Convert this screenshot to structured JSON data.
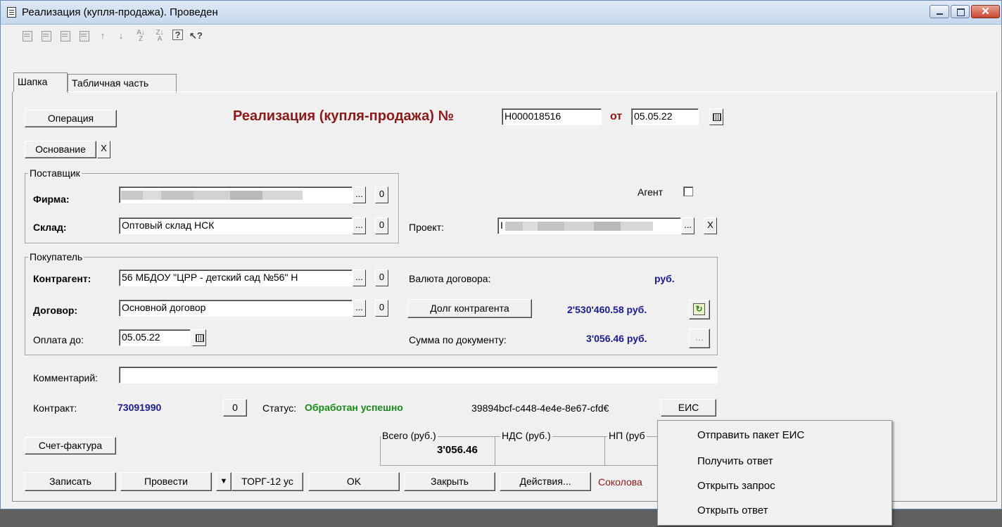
{
  "window": {
    "title": "Реализация (купля-продажа). Проведен",
    "close_glyph": "✕"
  },
  "toolbar": {
    "icons": [
      "new-doc-icon",
      "copy-doc-icon",
      "edit-doc-icon",
      "delete-doc-icon",
      "move-up-icon",
      "move-down-icon",
      "sort-asc-icon",
      "sort-desc-icon",
      "help-icon",
      "context-help-icon"
    ]
  },
  "tabs": [
    {
      "label": "Шапка"
    },
    {
      "label": "Табличная часть"
    }
  ],
  "header": {
    "operation_button": "Операция",
    "doc_title": "Реализация (купля-продажа) №",
    "doc_number": "Н000018516",
    "date_label": "от",
    "doc_date": "05.05.22",
    "basis_button": "Основание",
    "basis_clear": "X"
  },
  "supplier": {
    "group_title": "Поставщик",
    "firm_label": "Фирма:",
    "firm_value": "",
    "warehouse_label": "Склад:",
    "warehouse_value": "Оптовый склад НСК",
    "ellipsis": "...",
    "zero": "0"
  },
  "right_top": {
    "agent_label": "Агент",
    "project_label": "Проект:",
    "project_value": "I",
    "project_clear": "X"
  },
  "buyer": {
    "group_title": "Покупатель",
    "counterparty_label": "Контрагент:",
    "counterparty_value": "56 МБДОУ \"ЦРР - детский сад №56\" Н",
    "contract_label": "Договор:",
    "contract_value": "Основной договор",
    "pay_until_label": "Оплата до:",
    "pay_until_value": "05.05.22",
    "currency_label": "Валюта договора:",
    "currency_value": "руб.",
    "debt_button": "Долг контрагента",
    "debt_value": "2'530'460.58 руб.",
    "doc_sum_label": "Сумма по документу:",
    "doc_sum_value": "3'056.46 руб.",
    "doc_sum_button": "..."
  },
  "comment": {
    "label": "Комментарий:",
    "value": ""
  },
  "contract": {
    "label": "Контракт:",
    "value": "73091990",
    "zero": "0",
    "status_label": "Статус:",
    "status_value": "Обработан успешно",
    "guid": "39894bcf-c448-4e4e-8e67-cfd€",
    "eis_button": "ЕИС"
  },
  "invoice_button": "Счет-фактура",
  "totals": {
    "total_label": "Всего (руб.)",
    "total_value": "3'056.46",
    "vat_label": "НДС (руб.)",
    "np_label": "НП (руб"
  },
  "bottom_buttons": {
    "save": "Записать",
    "post": "Провести",
    "dropdown_glyph": "▼",
    "print": "ТОРГ-12 ус",
    "ok": "OK",
    "close": "Закрыть",
    "actions": "Действия...",
    "user": "Соколова"
  },
  "context_menu": {
    "items": [
      "Отправить пакет ЕИС",
      "Получить ответ",
      "Открыть запрос",
      "Открыть ответ"
    ]
  }
}
